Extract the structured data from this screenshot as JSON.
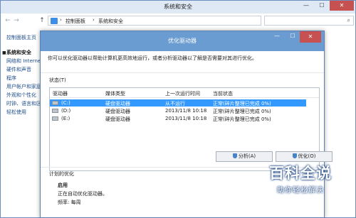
{
  "background_window": {
    "title": "系统和安全",
    "controls": {
      "minimize": "—",
      "maximize": "☐",
      "close": "✕"
    },
    "nav": {
      "back": "←",
      "forward": "→",
      "up": "↑"
    },
    "breadcrumbs": [
      "控制面板",
      "系统和安全"
    ],
    "breadcrumb_separator": "›",
    "sidebar": {
      "items": [
        {
          "label": "控制面板主页"
        },
        {
          "label": "系统和安全",
          "current": true
        },
        {
          "label": "网络和 Internet"
        },
        {
          "label": "硬件和声音"
        },
        {
          "label": "程序"
        },
        {
          "label": "用户帐户和家庭"
        },
        {
          "label": "外观和个性化"
        },
        {
          "label": "时钟、语言和区域"
        },
        {
          "label": "轻松使用"
        }
      ]
    }
  },
  "dialog": {
    "title": "优化驱动器",
    "controls": {
      "minimize": "—",
      "maximize": "☐",
      "close": "✕"
    },
    "description": "你可以优化驱动器以帮助计算机更高效地运行，或者分析驱动器以了解是否需要对其进行优化。",
    "status_label": "状态(T)",
    "table": {
      "headers": [
        "驱动器",
        "媒体类型",
        "上一次运行时间",
        "当前状态"
      ],
      "rows": [
        {
          "drive": "(C:)",
          "media": "硬盘驱动器",
          "last_run": "从不运行",
          "status": "正常(碎片整理已完成 0%)",
          "selected": true
        },
        {
          "drive": "(D:)",
          "media": "硬盘驱动器",
          "last_run": "2013/11/8 10:18",
          "status": "正常(碎片整理已完成 0%)"
        },
        {
          "drive": "(E:)",
          "media": "硬盘驱动器",
          "last_run": "2013/11/8 10:18",
          "status": "正常(碎片整理已完成 0%)"
        }
      ]
    },
    "buttons": {
      "analyze": "分析(A)",
      "optimize": "优化(O)"
    },
    "schedule": {
      "label": "计划的优化",
      "status": "启用",
      "auto_text": "正在自动优化驱动器。",
      "frequency": "频率: 每周"
    }
  },
  "watermark": {
    "title": "百科全说",
    "subtitle": "助你轻松解决"
  },
  "colors": {
    "dialog_titlebar": "#6a9bd1",
    "selection": "#3399ff",
    "close_button": "#c75050",
    "link": "#1f4e8c"
  }
}
